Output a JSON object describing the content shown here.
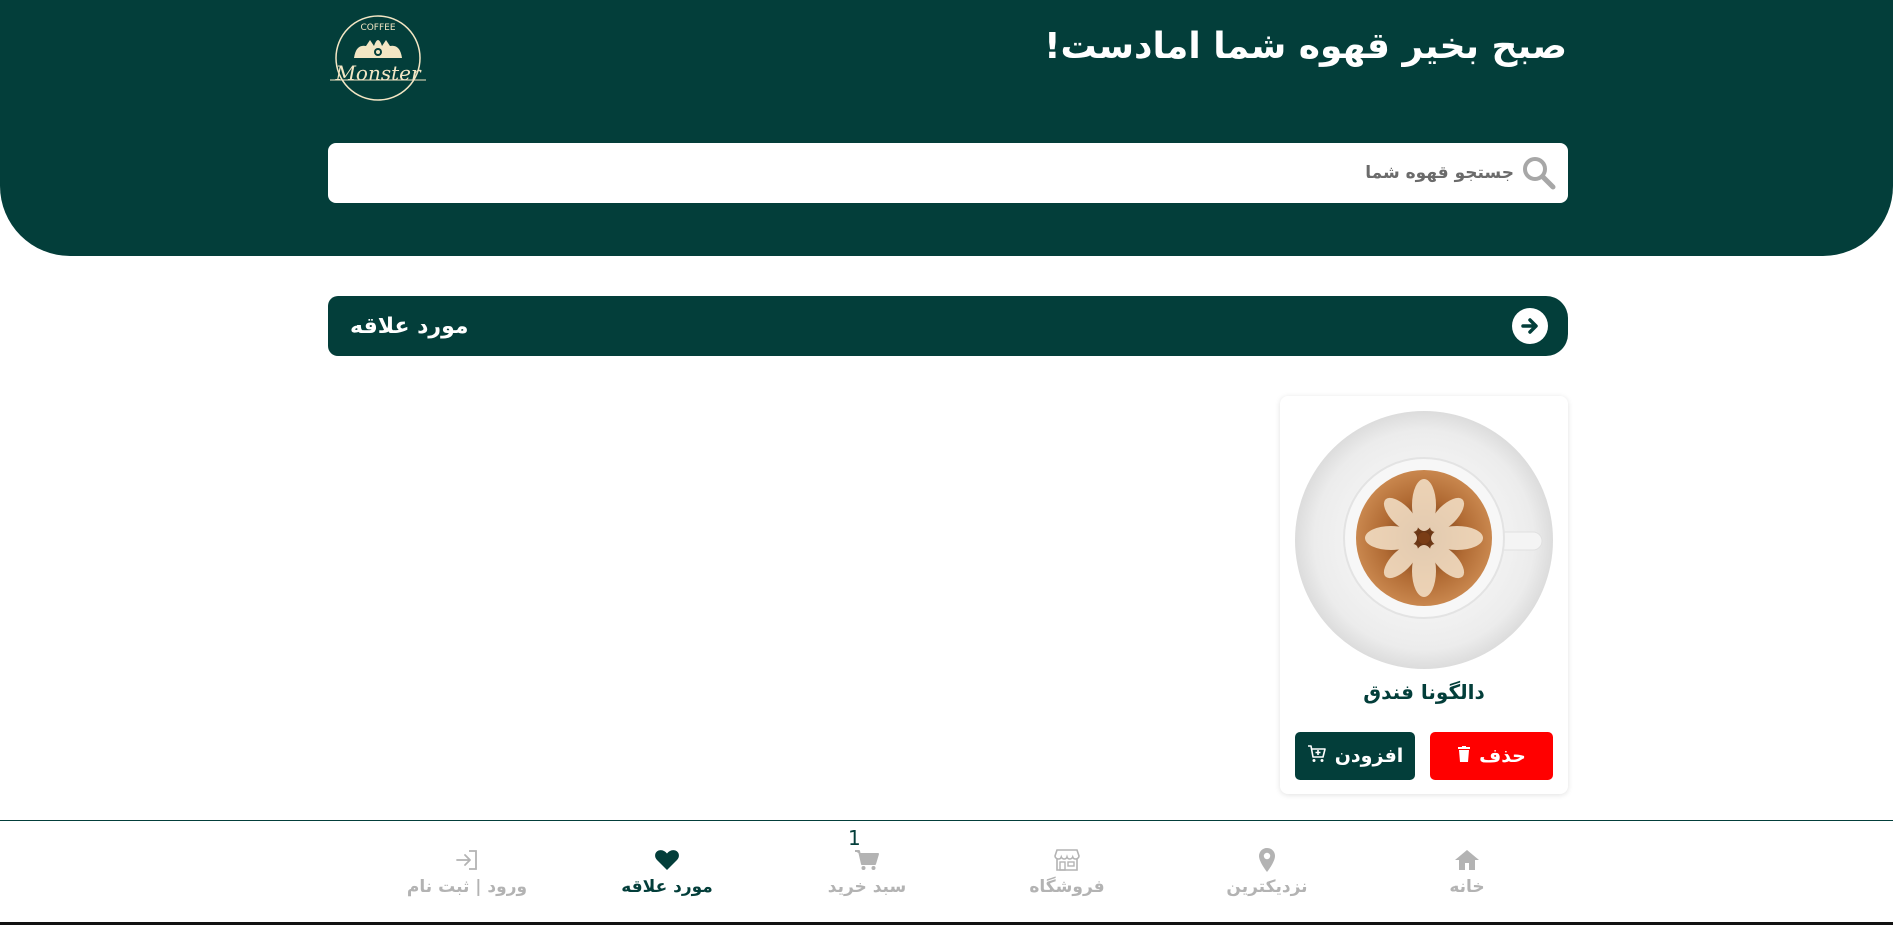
{
  "header": {
    "greeting": "صبح بخیر قهوه شما امادست!",
    "logo_text_top": "COFFEE",
    "logo_text_bottom": "Monster"
  },
  "search": {
    "placeholder": "جستجو قهوه شما",
    "icon": "search-icon"
  },
  "section": {
    "title": "مورد علاقه",
    "arrow_icon": "arrow-right-circle-icon"
  },
  "favorites": [
    {
      "name": "دالگونا فندق",
      "image": "latte-art-cup",
      "delete_label": "حذف",
      "add_label": "افزودن"
    }
  ],
  "bottom_nav": {
    "cart_count": "1",
    "items": [
      {
        "label": "خانه",
        "icon": "home-icon"
      },
      {
        "label": "نزدیکترین",
        "icon": "map-pin-icon"
      },
      {
        "label": "فروشگاه",
        "icon": "store-icon"
      },
      {
        "label": "سبد خرید",
        "icon": "cart-icon"
      },
      {
        "label": "مورد علاقه",
        "icon": "heart-icon"
      },
      {
        "label": "ورود | ثبت نام",
        "icon": "login-icon"
      }
    ]
  },
  "colors": {
    "primary": "#033e3a",
    "danger": "#ff0000",
    "inactive": "#b3b3b3",
    "logo": "#f3e6c4"
  }
}
